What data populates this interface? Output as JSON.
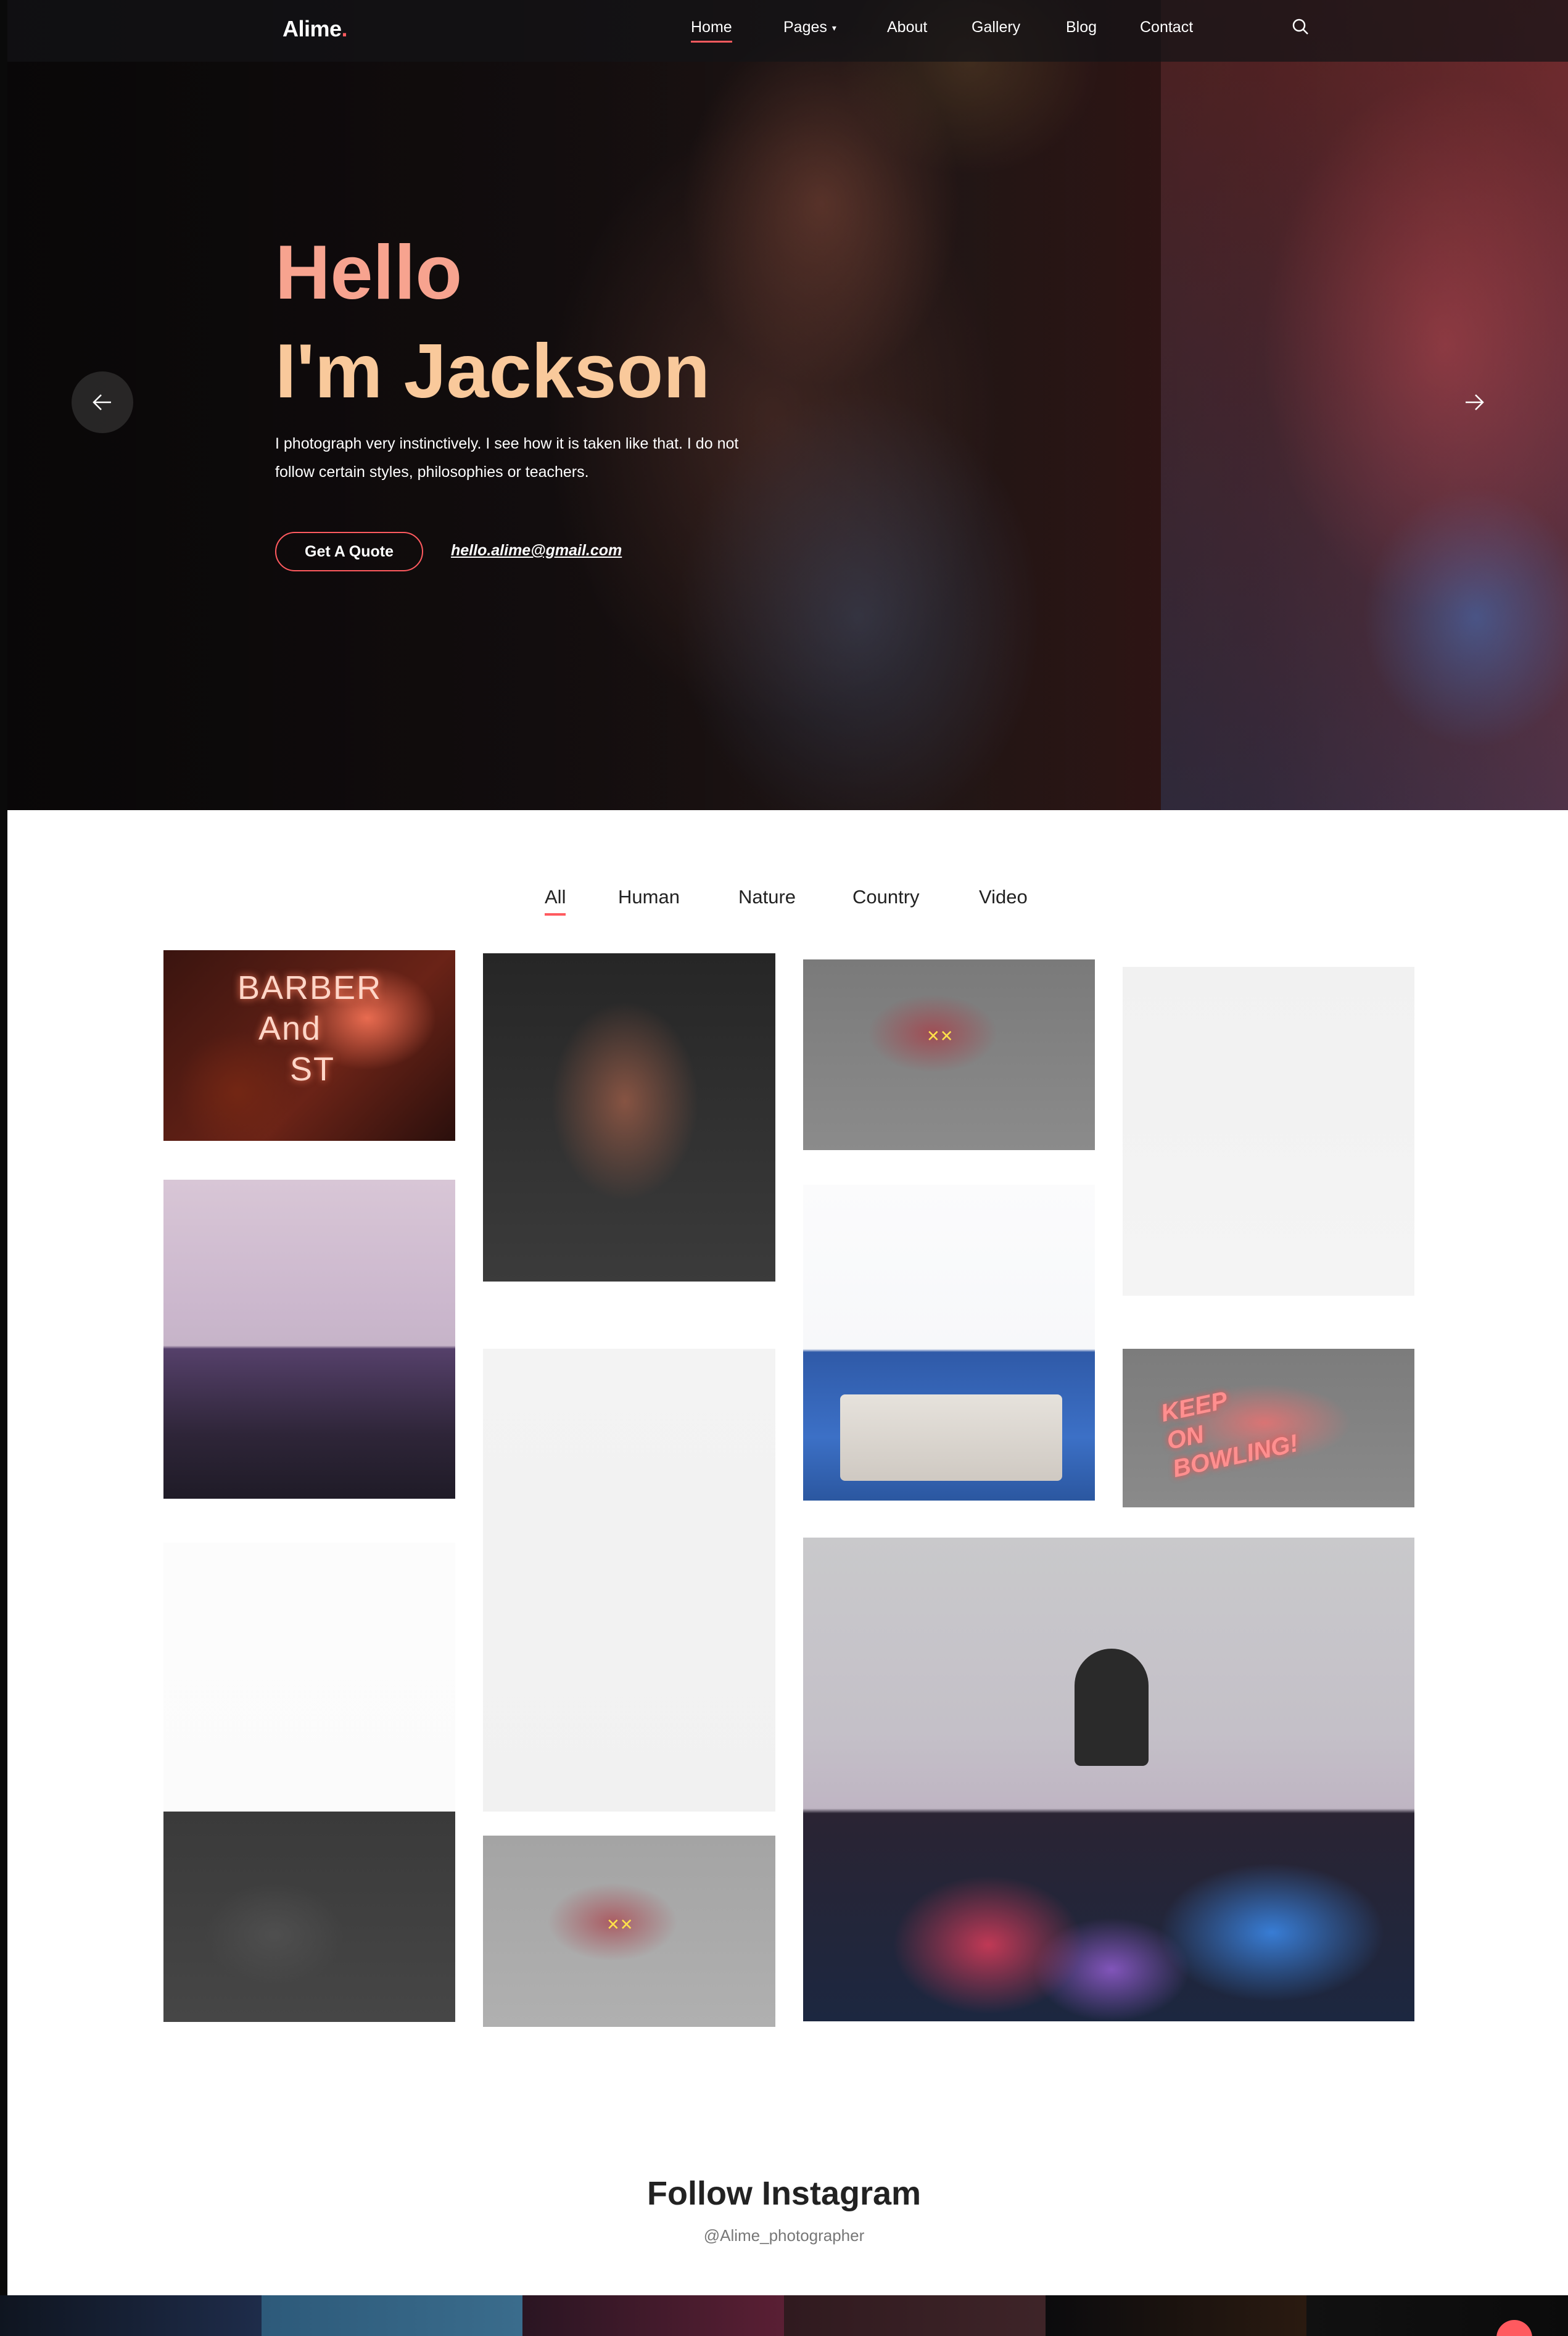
{
  "header": {
    "logo": "Alime",
    "logo_dot": ".",
    "nav": [
      {
        "label": "Home",
        "active": true
      },
      {
        "label": "Pages",
        "has_dropdown": true
      },
      {
        "label": "About"
      },
      {
        "label": "Gallery"
      },
      {
        "label": "Blog"
      },
      {
        "label": "Contact"
      }
    ],
    "search_icon": "search-icon"
  },
  "hero": {
    "title_line1": "Hello",
    "title_line2": "I'm Jackson",
    "description": "I photograph very instinctively. I see how it is taken like that. I do not follow certain styles, philosophies or teachers.",
    "quote_button": "Get A Quote",
    "email": "hello.alime@gmail.com",
    "prev_icon": "arrow-left-icon",
    "next_icon": "arrow-right-icon"
  },
  "gallery": {
    "filters": [
      {
        "label": "All",
        "active": true
      },
      {
        "label": "Human"
      },
      {
        "label": "Nature"
      },
      {
        "label": "Country"
      },
      {
        "label": "Video"
      }
    ],
    "tile_barber_text": "BARBER\nAnd\nST",
    "tile_bowling_text": "KEEP\nON\nBOWLING!"
  },
  "instagram": {
    "title": "Follow Instagram",
    "handle": "@Alime_photographer"
  },
  "colors": {
    "accent": "#ff5a5f",
    "hero_title_1": "#f7a38f",
    "hero_title_2": "#f9c99b",
    "text_dark": "#222222"
  }
}
